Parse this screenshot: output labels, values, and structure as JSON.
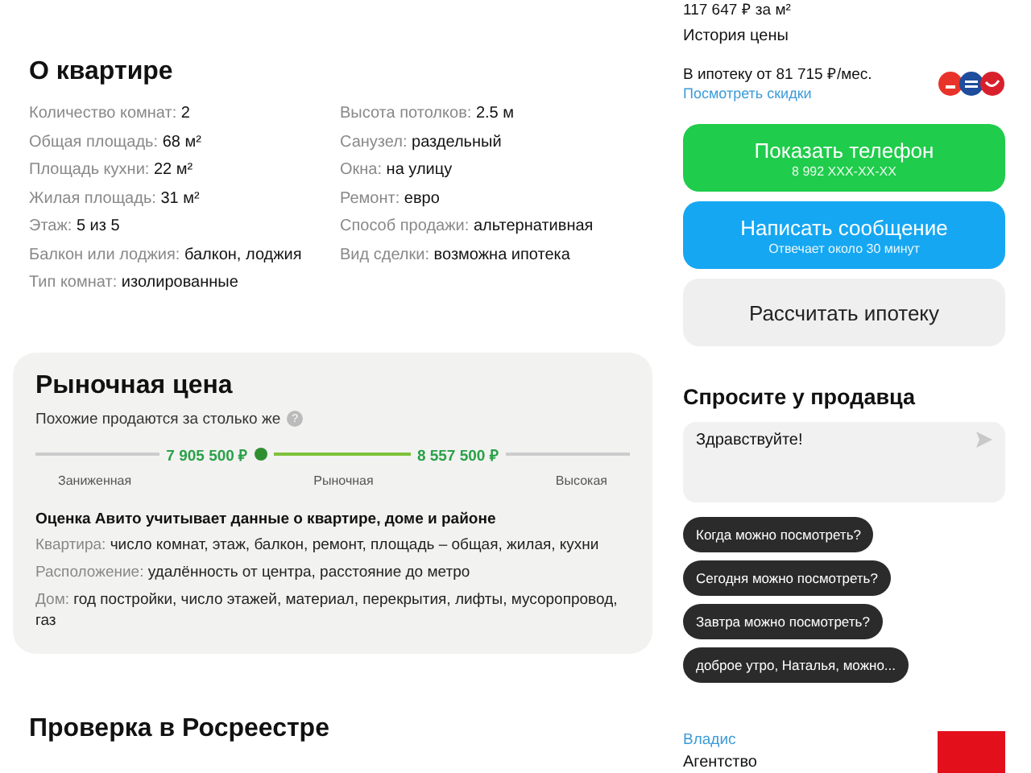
{
  "about": {
    "title": "О квартире",
    "left": [
      {
        "label": "Количество комнат:",
        "value": "2"
      },
      {
        "label": "Общая площадь:",
        "value": "68 м²"
      },
      {
        "label": "Площадь кухни:",
        "value": "22 м²"
      },
      {
        "label": "Жилая площадь:",
        "value": "31 м²"
      },
      {
        "label": "Этаж:",
        "value": "5 из 5"
      },
      {
        "label": "Балкон или лоджия:",
        "value": "балкон, лоджия"
      },
      {
        "label": "Тип комнат:",
        "value": "изолированные"
      }
    ],
    "right": [
      {
        "label": "Высота потолков:",
        "value": "2.5 м"
      },
      {
        "label": "Санузел:",
        "value": "раздельный"
      },
      {
        "label": "Окна:",
        "value": "на улицу"
      },
      {
        "label": "Ремонт:",
        "value": "евро"
      },
      {
        "label": "Способ продажи:",
        "value": "альтернативная"
      },
      {
        "label": "Вид сделки:",
        "value": "возможна ипотека"
      }
    ]
  },
  "market": {
    "title": "Рыночная цена",
    "subtitle": "Похожие продаются за столько же",
    "help_icon": "?",
    "low_price": "7 905 500 ₽",
    "high_price": "8 557 500 ₽",
    "scale": [
      "Заниженная",
      "Рыночная",
      "Высокая"
    ],
    "note_title": "Оценка Авито учитывает данные о квартире, доме и районе",
    "notes": [
      {
        "label": "Квартира:",
        "value": "число комнат, этаж, балкон, ремонт, площадь – общая, жилая, кухни"
      },
      {
        "label": "Расположение:",
        "value": "удалённость от центра, расстояние до метро"
      },
      {
        "label": "Дом:",
        "value": "год постройки, число этажей, материал, перекрытия, лифты, мусоропровод, газ"
      }
    ]
  },
  "rosreestr": {
    "title": "Проверка в Росреестре"
  },
  "sidebar": {
    "price_per_meter": "117 647 ₽ за м²",
    "price_history": "История цены",
    "mortgage": "В ипотеку от 81 715 ₽/мес.",
    "discounts_link": "Посмотреть скидки",
    "buttons": [
      {
        "kind": "green",
        "label": "Показать телефон",
        "sub": "8 992 XXX-XX-XX"
      },
      {
        "kind": "blue",
        "label": "Написать сообщение",
        "sub": "Отвечает около 30 минут"
      },
      {
        "kind": "grey",
        "label": "Рассчитать ипотеку"
      }
    ],
    "ask_title": "Спросите у продавца",
    "message": "Здравствуйте!",
    "quick_replies": [
      "Когда можно посмотреть?",
      "Сегодня можно посмотреть?",
      "Завтра можно посмотреть?",
      "доброе утро, Наталья, можно..."
    ],
    "seller_name": "Владис",
    "seller_type": "Агентство"
  }
}
